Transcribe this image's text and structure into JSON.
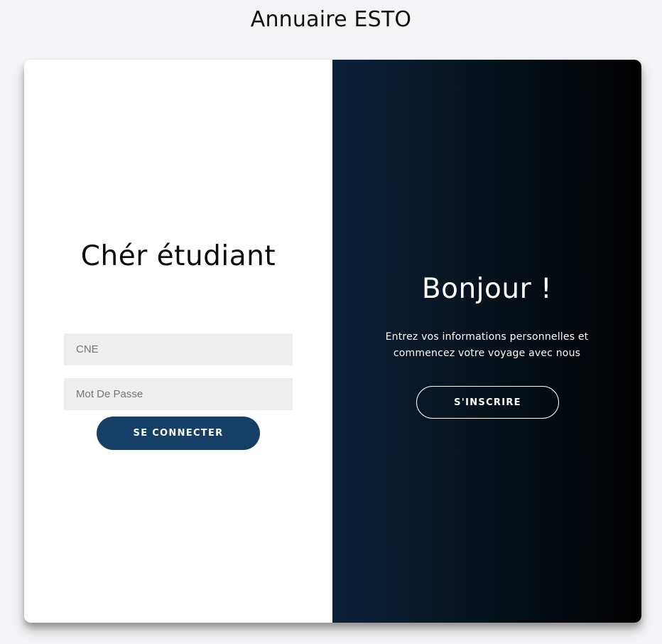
{
  "page": {
    "title": "Annuaire ESTO"
  },
  "login": {
    "heading": "Chér étudiant",
    "cne_placeholder": "CNE",
    "password_placeholder": "Mot De Passe",
    "submit_label": "SE CONNECTER"
  },
  "welcome": {
    "heading": "Bonjour !",
    "text": "Entrez vos informations personnelles et commencez votre voyage avec nous",
    "signup_label": "S'INSCRIRE"
  },
  "colors": {
    "page_background": "#f4f4f6",
    "login_button": "#153f66",
    "input_background": "#eeeeee",
    "gradient_start": "#0c2039",
    "gradient_end": "#000000"
  }
}
